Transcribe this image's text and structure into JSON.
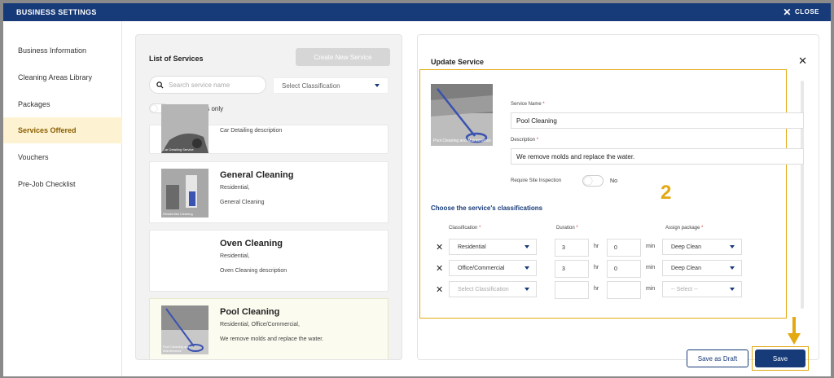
{
  "header": {
    "title": "BUSINESS SETTINGS",
    "close_label": "CLOSE"
  },
  "sidebar": {
    "items": [
      {
        "label": "Business Information"
      },
      {
        "label": "Cleaning Areas Library"
      },
      {
        "label": "Packages"
      },
      {
        "label": "Services Offered",
        "active": true
      },
      {
        "label": "Vouchers"
      },
      {
        "label": "Pre-Job Checklist"
      }
    ]
  },
  "services_list": {
    "title": "List of Services",
    "create_label": "Create New Service",
    "search_placeholder": "Search service name",
    "classification_placeholder": "Select Classification",
    "drafts_label": "Show drafts only",
    "cards": [
      {
        "name": "",
        "classification": "",
        "description": "Car Detailing description",
        "thumb_caption": "Car Detailing Service"
      },
      {
        "name": "General Cleaning",
        "classification": "Residential,",
        "description": "General Cleaning",
        "thumb_caption": "Residential Cleaning"
      },
      {
        "name": "Oven Cleaning",
        "classification": "Residential,",
        "description": "Oven Cleaning description",
        "thumb_caption": ""
      },
      {
        "name": "Pool Cleaning",
        "classification": "Residential, Office/Commercial,",
        "description": "We remove molds and replace the water.",
        "thumb_caption": "Pool Cleaning and Maintenance"
      }
    ]
  },
  "update": {
    "title": "Update Service",
    "thumb_caption": "Pool Cleaning and Maintenance",
    "name_label": "Service Name",
    "name_value": "Pool Cleaning",
    "desc_label": "Description",
    "desc_value": "We remove molds and replace the water.",
    "inspection_label": "Require Site Inspection",
    "inspection_value": "No",
    "step_marker": "2",
    "classifications_title": "Choose the service's classifications",
    "col_classification": "Classification",
    "col_duration": "Duration",
    "col_package": "Assign package",
    "hr_unit": "hr",
    "min_unit": "min",
    "rows": [
      {
        "classification": "Residential",
        "hr": "3",
        "min": "0",
        "package": "Deep Clean"
      },
      {
        "classification": "Office/Commercial",
        "hr": "3",
        "min": "0",
        "package": "Deep Clean"
      },
      {
        "classification": "Select Classification",
        "hr": "",
        "min": "",
        "package": "-- Select --"
      }
    ],
    "draft_label": "Save as Draft",
    "save_label": "Save"
  },
  "colors": {
    "primary": "#173a78",
    "highlight": "#e3a912",
    "active_bg": "#fdf3d2"
  }
}
